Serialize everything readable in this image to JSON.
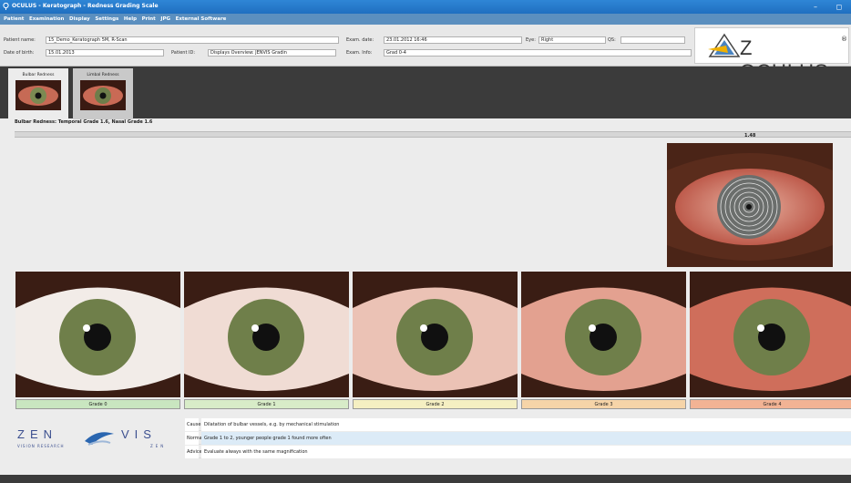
{
  "window": {
    "title": "OCULUS - Keratograph - Redness Grading Scale",
    "controls": [
      "–",
      "◻"
    ]
  },
  "menu": [
    "Patient",
    "Examination",
    "Display",
    "Settings",
    "Help",
    "Print",
    "JPG",
    "External Software"
  ],
  "patient": {
    "name_label": "Patient name:",
    "name_value": "15_Demo_Keratograph 5M, R-Scan",
    "dob_label": "Date of birth:",
    "dob_value": "15.01.2013",
    "id_label": "Patient ID:",
    "id_value": "Displays Overview: JENVIS Gradin"
  },
  "exam": {
    "date_label": "Exam. date:",
    "date_value": "23.01.2012 16:46",
    "info_label": "Exam. Info:",
    "info_value": "Grad 0-4",
    "eye_label": "Eye:",
    "eye_value": "Right",
    "qs_label": "QS:",
    "qs_value": ""
  },
  "brand": {
    "logo_text": "Z OCULUS",
    "registered": "®",
    "brand_color": "#2a6fb5"
  },
  "tabs": [
    {
      "label": "Bulbar Redness",
      "active": true
    },
    {
      "label": "Limbal Redness",
      "active": false
    }
  ],
  "result_text": "Bulbar Redness: Temporal Grade 1.6, Nasal Grade 1.6",
  "progress_value": "1.48",
  "grades": [
    {
      "label": "Grade 0",
      "color": "#c9e6c0",
      "redness": 0.0
    },
    {
      "label": "Grade 1",
      "color": "#d8ecc8",
      "redness": 0.25
    },
    {
      "label": "Grade 2",
      "color": "#f5efc2",
      "redness": 0.5
    },
    {
      "label": "Grade 3",
      "color": "#f6d4a8",
      "redness": 0.75
    },
    {
      "label": "Grade 4",
      "color": "#f2b394",
      "redness": 1.0
    }
  ],
  "footer_logo": {
    "left_word": "ZEN",
    "right_word": "VIS",
    "left_sub": "VISION RESEARCH",
    "right_sub": "ZEN"
  },
  "info": [
    {
      "key": "Cause",
      "value": "Dilatation of bulbar vessels, e.g. by mechanical stimulation",
      "bg": "#ffffff"
    },
    {
      "key": "Normal",
      "value": "Grade 1 to 2, younger people grade 1 found more often",
      "bg": "#dcebf7"
    },
    {
      "key": "Advice",
      "value": "Evaluate always with the same magnification",
      "bg": "#ffffff"
    }
  ]
}
